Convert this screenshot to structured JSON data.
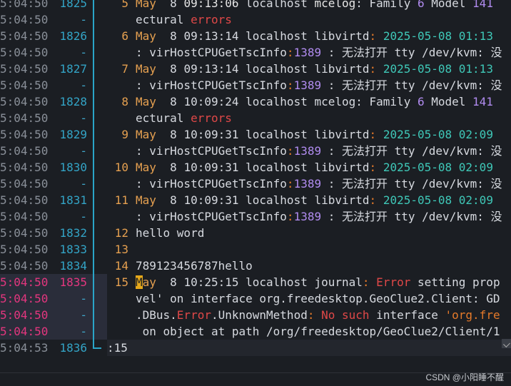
{
  "rows": [
    {
      "ts": "5:04:50]",
      "ln": "1825",
      "fnum": "5",
      "seg": [
        [
          "k-month",
          "May"
        ],
        [
          "",
          "  8 "
        ],
        [
          "k-white",
          "09:13:06"
        ],
        [
          "",
          " localhost "
        ],
        [
          "k-white",
          "mcelog"
        ],
        [
          "",
          ": Family "
        ],
        [
          "k-purple",
          "6"
        ],
        [
          "",
          " Model "
        ],
        [
          "k-purple",
          "141"
        ]
      ]
    },
    {
      "ts": "5:04:50]",
      "ln": "-",
      "fnum": "",
      "seg": [
        [
          "",
          "ectural "
        ],
        [
          "k-red",
          "errors"
        ]
      ]
    },
    {
      "ts": "5:04:50]",
      "ln": "1826",
      "fnum": "6",
      "seg": [
        [
          "k-month",
          "May"
        ],
        [
          "",
          "  8 09:13:14 localhost libvirtd"
        ],
        [
          "k-orange",
          ":"
        ],
        [
          "",
          " "
        ],
        [
          "k-teal",
          "2025-05-08"
        ],
        [
          "",
          " "
        ],
        [
          "k-teal",
          "01:13"
        ]
      ]
    },
    {
      "ts": "5:04:50]",
      "ln": "-",
      "fnum": "",
      "seg": [
        [
          "",
          ": virHostCPUGetTscInfo"
        ],
        [
          "k-orange",
          ":"
        ],
        [
          "k-purple",
          "1389"
        ],
        [
          "",
          " : 无法打开 tty /dev/kvm: 没"
        ]
      ]
    },
    {
      "ts": "5:04:50]",
      "ln": "1827",
      "fnum": "7",
      "seg": [
        [
          "k-month",
          "May"
        ],
        [
          "",
          "  8 09:13:14 localhost libvirtd"
        ],
        [
          "k-orange",
          ":"
        ],
        [
          "",
          " "
        ],
        [
          "k-teal",
          "2025-05-08"
        ],
        [
          "",
          " "
        ],
        [
          "k-teal",
          "01:13"
        ]
      ]
    },
    {
      "ts": "5:04:50]",
      "ln": "-",
      "fnum": "",
      "seg": [
        [
          "",
          ": virHostCPUGetTscInfo"
        ],
        [
          "k-orange",
          ":"
        ],
        [
          "k-purple",
          "1389"
        ],
        [
          "",
          " : 无法打开 tty /dev/kvm: 没"
        ]
      ]
    },
    {
      "ts": "5:04:50]",
      "ln": "1828",
      "fnum": "8",
      "seg": [
        [
          "k-month",
          "May"
        ],
        [
          "",
          "  8 10:09:24 localhost mcelog: Family "
        ],
        [
          "k-purple",
          "6"
        ],
        [
          "",
          " Model "
        ],
        [
          "k-purple",
          "141"
        ]
      ]
    },
    {
      "ts": "5:04:50]",
      "ln": "-",
      "fnum": "",
      "seg": [
        [
          "",
          "ectural "
        ],
        [
          "k-red",
          "errors"
        ]
      ]
    },
    {
      "ts": "5:04:50]",
      "ln": "1829",
      "fnum": "9",
      "seg": [
        [
          "k-month",
          "May"
        ],
        [
          "",
          "  8 10:09:31 localhost libvirtd"
        ],
        [
          "k-orange",
          ":"
        ],
        [
          "",
          " "
        ],
        [
          "k-teal",
          "2025-05-08"
        ],
        [
          "",
          " "
        ],
        [
          "k-teal",
          "02:09"
        ]
      ]
    },
    {
      "ts": "5:04:50]",
      "ln": "-",
      "fnum": "",
      "seg": [
        [
          "",
          ": virHostCPUGetTscInfo"
        ],
        [
          "k-orange",
          ":"
        ],
        [
          "k-purple",
          "1389"
        ],
        [
          "",
          " : 无法打开 tty /dev/kvm: 没"
        ]
      ]
    },
    {
      "ts": "5:04:50]",
      "ln": "1830",
      "fnum": "10",
      "seg": [
        [
          "k-month",
          "May"
        ],
        [
          "",
          "  8 10:09:31 localhost libvirtd"
        ],
        [
          "k-orange",
          ":"
        ],
        [
          "",
          " "
        ],
        [
          "k-teal",
          "2025-05-08"
        ],
        [
          "",
          " "
        ],
        [
          "k-teal",
          "02:09"
        ]
      ]
    },
    {
      "ts": "5:04:50]",
      "ln": "-",
      "fnum": "",
      "seg": [
        [
          "",
          ": virHostCPUGetTscInfo"
        ],
        [
          "k-orange",
          ":"
        ],
        [
          "k-purple",
          "1389"
        ],
        [
          "",
          " : 无法打开 tty /dev/kvm: 没"
        ]
      ]
    },
    {
      "ts": "5:04:50]",
      "ln": "1831",
      "fnum": "11",
      "seg": [
        [
          "k-month",
          "May"
        ],
        [
          "",
          "  8 10:09:31 localhost libvirtd"
        ],
        [
          "k-orange",
          ":"
        ],
        [
          "",
          " "
        ],
        [
          "k-teal",
          "2025-05-08"
        ],
        [
          "",
          " "
        ],
        [
          "k-teal",
          "02:09"
        ]
      ]
    },
    {
      "ts": "5:04:50]",
      "ln": "-",
      "fnum": "",
      "seg": [
        [
          "",
          ": virHostCPUGetTscInfo"
        ],
        [
          "k-orange",
          ":"
        ],
        [
          "k-purple",
          "1389"
        ],
        [
          "",
          " : 无法打开 tty /dev/kvm: 没"
        ]
      ]
    },
    {
      "ts": "5:04:50]",
      "ln": "1832",
      "fnum": "12",
      "seg": [
        [
          "",
          "hello word"
        ]
      ]
    },
    {
      "ts": "5:04:50]",
      "ln": "1833",
      "fnum": "13",
      "seg": []
    },
    {
      "ts": "5:04:50]",
      "ln": "1834",
      "fnum": "14",
      "seg": [
        [
          "",
          "789123456787hello"
        ]
      ]
    },
    {
      "ts": "5:04:50]",
      "ln": "1835",
      "fnum": "15",
      "mag": true,
      "seg": [
        [
          "cursor",
          "M"
        ],
        [
          "k-month",
          "ay"
        ],
        [
          "",
          "  8 10:25:15 localhost journal"
        ],
        [
          "k-orange",
          ":"
        ],
        [
          "",
          " "
        ],
        [
          "k-red",
          "Error"
        ],
        [
          "",
          " setting prop"
        ]
      ]
    },
    {
      "ts": "5:04:50]",
      "ln": "-",
      "fnum": "",
      "mag": true,
      "seg": [
        [
          "",
          "vel' on interface org.freedesktop.GeoClue2.Client: GD"
        ]
      ]
    },
    {
      "ts": "5:04:50]",
      "ln": "-",
      "fnum": "",
      "mag": true,
      "seg": [
        [
          "",
          ".DBus."
        ],
        [
          "k-red",
          "Error"
        ],
        [
          "",
          ".UnknownMethod"
        ],
        [
          "k-orange",
          ":"
        ],
        [
          "",
          " "
        ],
        [
          "k-red",
          "No such"
        ],
        [
          "",
          " interface "
        ],
        [
          "k-orange",
          "'org.fre"
        ]
      ]
    },
    {
      "ts": "5:04:50]",
      "ln": "-",
      "fnum": "",
      "mag": true,
      "seg": [
        [
          "",
          ""
        ],
        [
          "",
          " on object at path /org/freedesktop/GeoClue2/Client/1"
        ]
      ]
    },
    {
      "ts": "5:04:53]",
      "ln": "1836",
      "fnum": "",
      "seg": []
    }
  ],
  "cmdline": ":15",
  "watermark": "CSDN @小阳睡不醒"
}
